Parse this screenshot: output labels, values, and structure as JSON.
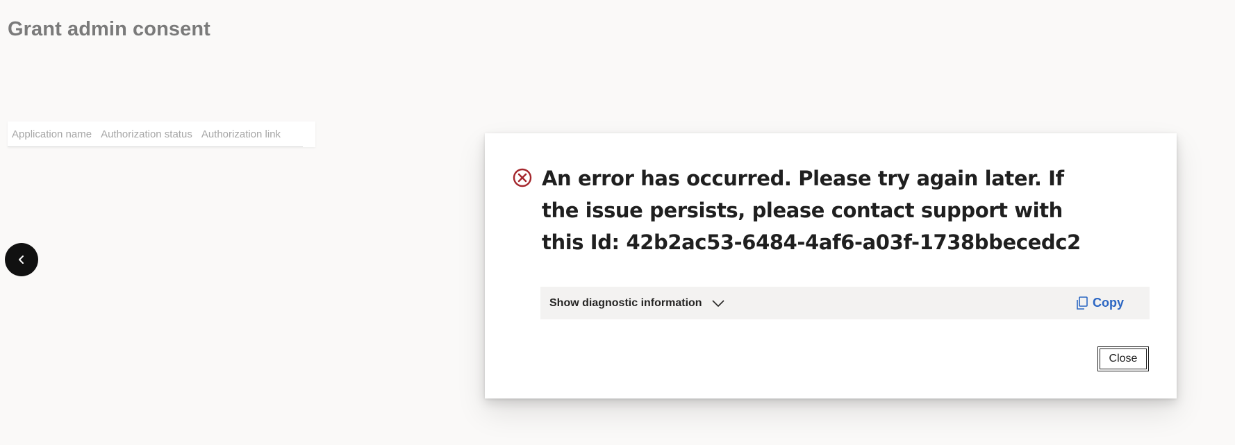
{
  "page": {
    "title": "Grant admin consent"
  },
  "table": {
    "columns": [
      "Application name",
      "Authorization status",
      "Authorization link"
    ]
  },
  "nav": {
    "back_icon": "chevron-left-icon"
  },
  "dialog": {
    "error_icon": "error-circle-icon",
    "message": "An error has occurred. Please try again later. If the issue persists, please contact support with this Id: 42b2ac53-6484-4af6-a03f-1738bbecedc2",
    "diagnostic_label": "Show diagnostic information",
    "diagnostic_icon": "chevron-down-icon",
    "copy_label": "Copy",
    "copy_icon": "copy-icon",
    "close_label": "Close"
  },
  "colors": {
    "background": "#faf9f8",
    "error_red": "#a4262c",
    "link_blue": "#2b66c3",
    "diag_bar_bg": "#f3f2f1"
  }
}
